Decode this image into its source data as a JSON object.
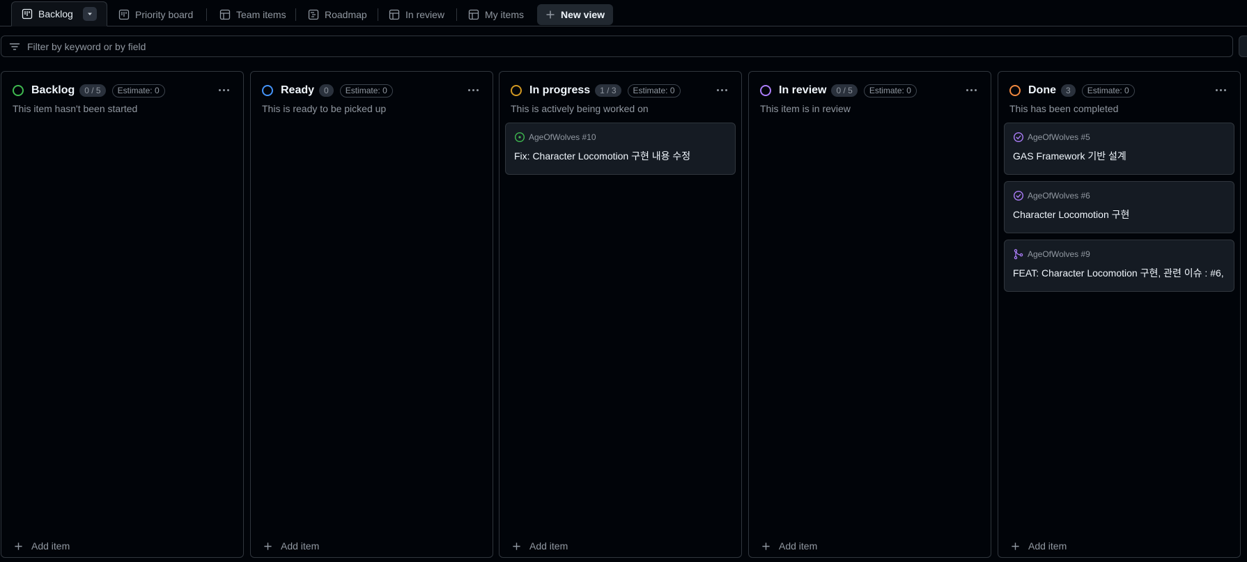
{
  "tabs": [
    {
      "label": "Backlog",
      "icon": "board-icon",
      "active": true
    },
    {
      "label": "Priority board",
      "icon": "board-icon"
    },
    {
      "label": "Team items",
      "icon": "table-icon"
    },
    {
      "label": "Roadmap",
      "icon": "roadmap-icon"
    },
    {
      "label": "In review",
      "icon": "table-icon"
    },
    {
      "label": "My items",
      "icon": "table-icon"
    }
  ],
  "new_view_label": "New view",
  "filter": {
    "placeholder": "Filter by keyword or by field"
  },
  "columns": [
    {
      "title": "Backlog",
      "count": "0 / 5",
      "estimate": "Estimate: 0",
      "description": "This item hasn't been started",
      "color": "#3fb950",
      "add_label": "Add item",
      "cards": []
    },
    {
      "title": "Ready",
      "count": "0",
      "estimate": "Estimate: 0",
      "description": "This is ready to be picked up",
      "color": "#4493f8",
      "add_label": "Add item",
      "cards": []
    },
    {
      "title": "In progress",
      "count": "1 / 3",
      "estimate": "Estimate: 0",
      "description": "This is actively being worked on",
      "color": "#d29922",
      "add_label": "Add item",
      "cards": [
        {
          "repo": "AgeOfWolves #10",
          "title": "Fix: Character Locomotion 구현 내용 수정",
          "icon": "open-issue-icon"
        }
      ]
    },
    {
      "title": "In review",
      "count": "0 / 5",
      "estimate": "Estimate: 0",
      "description": "This item is in review",
      "color": "#ab7df8",
      "add_label": "Add item",
      "cards": []
    },
    {
      "title": "Done",
      "count": "3",
      "estimate": "Estimate: 0",
      "description": "This has been completed",
      "color": "#f0883e",
      "add_label": "Add item",
      "cards": [
        {
          "repo": "AgeOfWolves #5",
          "title": "GAS Framework 기반 설계",
          "icon": "closed-issue-icon"
        },
        {
          "repo": "AgeOfWolves #6",
          "title": "Character Locomotion 구현",
          "icon": "closed-issue-icon"
        },
        {
          "repo": "AgeOfWolves #9",
          "title": "FEAT: Character Locomotion 구현, 관련 이슈 : #6,",
          "icon": "merged-pr-icon"
        }
      ]
    }
  ],
  "colors": {
    "open_issue": "#3fb950",
    "closed_issue": "#ab7df8",
    "merged_pr": "#ab7df8"
  }
}
